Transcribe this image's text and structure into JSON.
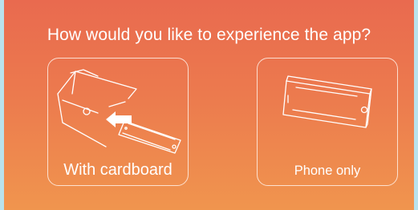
{
  "prompt": {
    "title": "How would you like to experience the app?"
  },
  "options": [
    {
      "label": "With cardboard",
      "icon": "cardboard-viewer-icon"
    },
    {
      "label": "Phone only",
      "icon": "smartphone-icon"
    }
  ],
  "colors": {
    "gradient_top": "#e96a4f",
    "gradient_bottom": "#f0954e",
    "text": "#ffffff",
    "page_background": "#b9e2ec"
  }
}
